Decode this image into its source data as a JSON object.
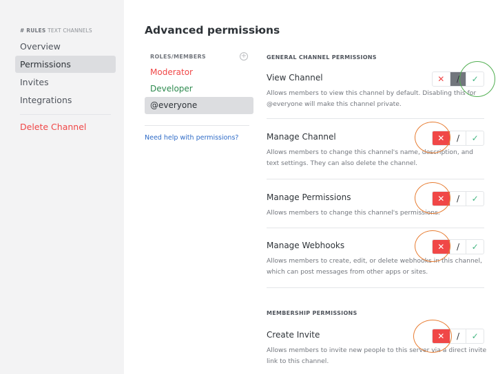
{
  "sidebar": {
    "header_channel": "# RULES",
    "header_category": "TEXT CHANNELS",
    "items": [
      "Overview",
      "Permissions",
      "Invites",
      "Integrations"
    ],
    "delete_label": "Delete Channel"
  },
  "header": {
    "title": "Advanced permissions",
    "chevron": "⌄"
  },
  "roles": {
    "title": "ROLES/MEMBERS",
    "add_icon": "+",
    "items": [
      {
        "label": "Moderator",
        "color": "#f04747"
      },
      {
        "label": "Developer",
        "color": "#2d8a4e"
      },
      {
        "label": "@everyone",
        "color": "#2e3338"
      }
    ],
    "selected": "@everyone",
    "help_link": "Need help with permissions?"
  },
  "permissions": {
    "general_title": "GENERAL CHANNEL PERMISSIONS",
    "membership_title": "MEMBERSHIP PERMISSIONS",
    "items": [
      {
        "name": "View Channel",
        "desc": "Allows members to view this channel by default. Disabling this for @everyone will make this channel private.",
        "state": "neutral"
      },
      {
        "name": "Manage Channel",
        "desc": "Allows members to change this channel's name, description, and text settings. They can also delete the channel.",
        "state": "deny"
      },
      {
        "name": "Manage Permissions",
        "desc": "Allows members to change this channel's permissions.",
        "state": "deny"
      },
      {
        "name": "Manage Webhooks",
        "desc": "Allows members to create, edit, or delete webhooks in this channel, which can post messages from other apps or sites.",
        "state": "deny"
      },
      {
        "name": "Create Invite",
        "desc": "Allows members to invite new people to this server via a direct invite link to this channel.",
        "state": "deny"
      }
    ]
  },
  "toggle_glyphs": {
    "deny": "✕",
    "neutral": "/",
    "allow": "✓"
  },
  "icons": {
    "deny": "close-icon",
    "neutral": "slash-icon",
    "allow": "check-icon"
  },
  "colors": {
    "deny": "#f04747",
    "allow": "#43b581",
    "highlight_green": "#4fae4f",
    "highlight_orange": "#e77b30"
  }
}
